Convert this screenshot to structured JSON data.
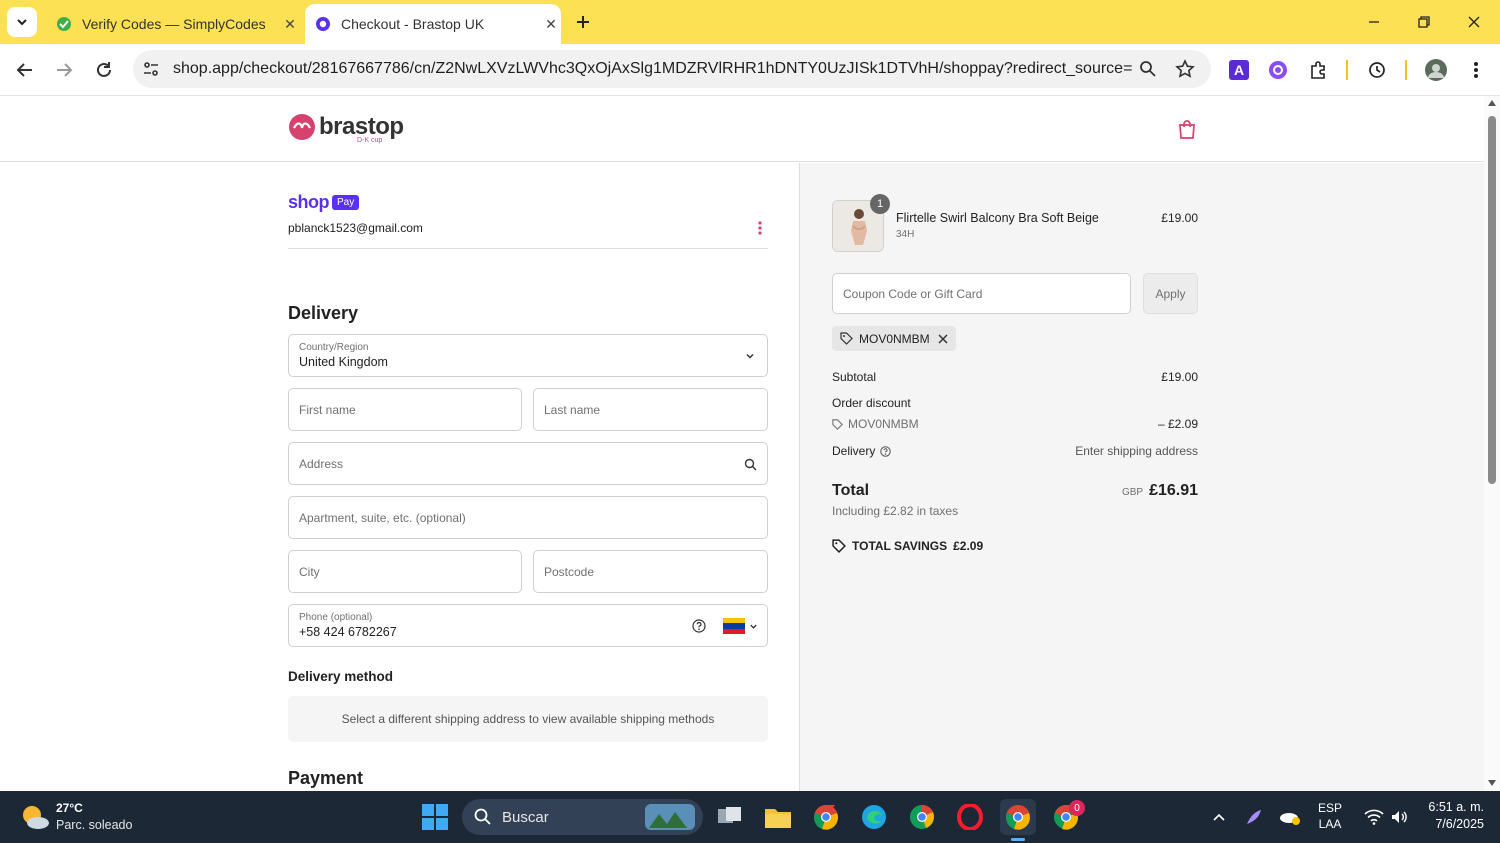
{
  "browser": {
    "tabs": [
      {
        "title": "Verify Codes — SimplyCodes",
        "active": false
      },
      {
        "title": "Checkout - Brastop UK",
        "active": true
      }
    ],
    "url": "shop.app/checkout/28167667786/cn/Z2NwLXVzLWVhc3QxOjAxSlg1MDZRVlRHR1hDNTY0UzJISk1DTVhH/shoppay?redirect_source=checko..."
  },
  "header": {
    "brand": "brastop",
    "tagline": "D-K cup"
  },
  "account": {
    "shop_label": "shop",
    "pay_badge": "Pay",
    "email": "pblanck1523@gmail.com"
  },
  "delivery": {
    "heading": "Delivery",
    "country_label": "Country/Region",
    "country_value": "United Kingdom",
    "first_name_ph": "First name",
    "last_name_ph": "Last name",
    "address_ph": "Address",
    "apartment_ph": "Apartment, suite, etc. (optional)",
    "city_ph": "City",
    "postcode_ph": "Postcode",
    "phone_label": "Phone (optional)",
    "phone_value": "+58 424 6782267"
  },
  "delivery_method": {
    "heading": "Delivery method",
    "message": "Select a different shipping address to view available shipping methods"
  },
  "payment": {
    "heading": "Payment"
  },
  "summary": {
    "item": {
      "qty": "1",
      "name": "Flirtelle Swirl Balcony Bra Soft Beige",
      "variant": "34H",
      "price": "£19.00"
    },
    "coupon_ph": "Coupon Code or Gift Card",
    "apply": "Apply",
    "code_chip": "MOV0NMBM",
    "subtotal_label": "Subtotal",
    "subtotal_value": "£19.00",
    "order_discount_label": "Order discount",
    "discount_code": "MOV0NMBM",
    "discount_value": "– £2.09",
    "delivery_label": "Delivery",
    "delivery_value": "Enter shipping address",
    "total_label": "Total",
    "currency": "GBP",
    "total_value": "£16.91",
    "taxes": "Including £2.82 in taxes",
    "savings_label": "TOTAL SAVINGS",
    "savings_value": "£2.09"
  },
  "taskbar": {
    "temp": "27°C",
    "weather": "Parc. soleado",
    "search": "Buscar",
    "lang1": "ESP",
    "lang2": "LAA",
    "time": "6:51 a. m.",
    "date": "7/6/2025",
    "badge": "0"
  },
  "colors": {
    "chrome_yellow": "#fbe153",
    "shop_purple": "#5a31f4",
    "brand_pink": "#d6426e",
    "taskbar": "#1d2836"
  }
}
